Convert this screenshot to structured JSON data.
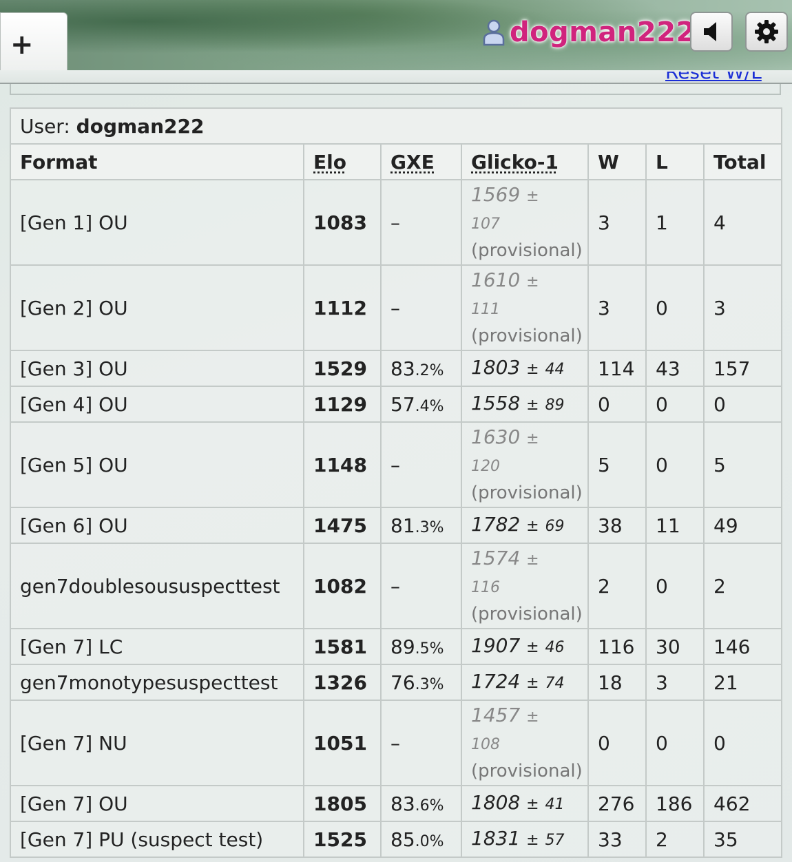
{
  "header": {
    "new_tab_label": "+",
    "username": "dogman222",
    "user_icon": "user-icon",
    "sound_icon": "speaker-icon",
    "settings_icon": "gear-icon",
    "accent_color": "#d0247d"
  },
  "reset_link": "Reset W/L",
  "table": {
    "user_label": "User:",
    "user_name": "dogman222",
    "headers": {
      "format": "Format",
      "elo": "Elo",
      "gxe": "GXE",
      "glicko": "Glicko-1",
      "w": "W",
      "l": "L",
      "total": "Total"
    },
    "rows": [
      {
        "format": "[Gen 1] OU",
        "elo": "1083",
        "gxe": "–",
        "gxe_pct": "",
        "glicko": "1569",
        "dev": "107",
        "provisional": "(provisional)",
        "w": "3",
        "l": "1",
        "total": "4"
      },
      {
        "format": "[Gen 2] OU",
        "elo": "1112",
        "gxe": "–",
        "gxe_pct": "",
        "glicko": "1610",
        "dev": "111",
        "provisional": "(provisional)",
        "w": "3",
        "l": "0",
        "total": "3"
      },
      {
        "format": "[Gen 3] OU",
        "elo": "1529",
        "gxe": "83",
        "gxe_pct": ".2%",
        "glicko": "1803",
        "dev": "44",
        "provisional": "",
        "w": "114",
        "l": "43",
        "total": "157"
      },
      {
        "format": "[Gen 4] OU",
        "elo": "1129",
        "gxe": "57",
        "gxe_pct": ".4%",
        "glicko": "1558",
        "dev": "89",
        "provisional": "",
        "w": "0",
        "l": "0",
        "total": "0"
      },
      {
        "format": "[Gen 5] OU",
        "elo": "1148",
        "gxe": "–",
        "gxe_pct": "",
        "glicko": "1630",
        "dev": "120",
        "provisional": "(provisional)",
        "w": "5",
        "l": "0",
        "total": "5"
      },
      {
        "format": "[Gen 6] OU",
        "elo": "1475",
        "gxe": "81",
        "gxe_pct": ".3%",
        "glicko": "1782",
        "dev": "69",
        "provisional": "",
        "w": "38",
        "l": "11",
        "total": "49"
      },
      {
        "format": "gen7doublesoususpecttest",
        "elo": "1082",
        "gxe": "–",
        "gxe_pct": "",
        "glicko": "1574",
        "dev": "116",
        "provisional": "(provisional)",
        "w": "2",
        "l": "0",
        "total": "2"
      },
      {
        "format": "[Gen 7] LC",
        "elo": "1581",
        "gxe": "89",
        "gxe_pct": ".5%",
        "glicko": "1907",
        "dev": "46",
        "provisional": "",
        "w": "116",
        "l": "30",
        "total": "146"
      },
      {
        "format": "gen7monotypesuspecttest",
        "elo": "1326",
        "gxe": "76",
        "gxe_pct": ".3%",
        "glicko": "1724",
        "dev": "74",
        "provisional": "",
        "w": "18",
        "l": "3",
        "total": "21"
      },
      {
        "format": "[Gen 7] NU",
        "elo": "1051",
        "gxe": "–",
        "gxe_pct": "",
        "glicko": "1457",
        "dev": "108",
        "provisional": "(provisional)",
        "w": "0",
        "l": "0",
        "total": "0"
      },
      {
        "format": "[Gen 7] OU",
        "elo": "1805",
        "gxe": "83",
        "gxe_pct": ".6%",
        "glicko": "1808",
        "dev": "41",
        "provisional": "",
        "w": "276",
        "l": "186",
        "total": "462"
      },
      {
        "format": "[Gen 7] PU (suspect test)",
        "elo": "1525",
        "gxe": "85",
        "gxe_pct": ".0%",
        "glicko": "1831",
        "dev": "57",
        "provisional": "",
        "w": "33",
        "l": "2",
        "total": "35"
      }
    ]
  }
}
